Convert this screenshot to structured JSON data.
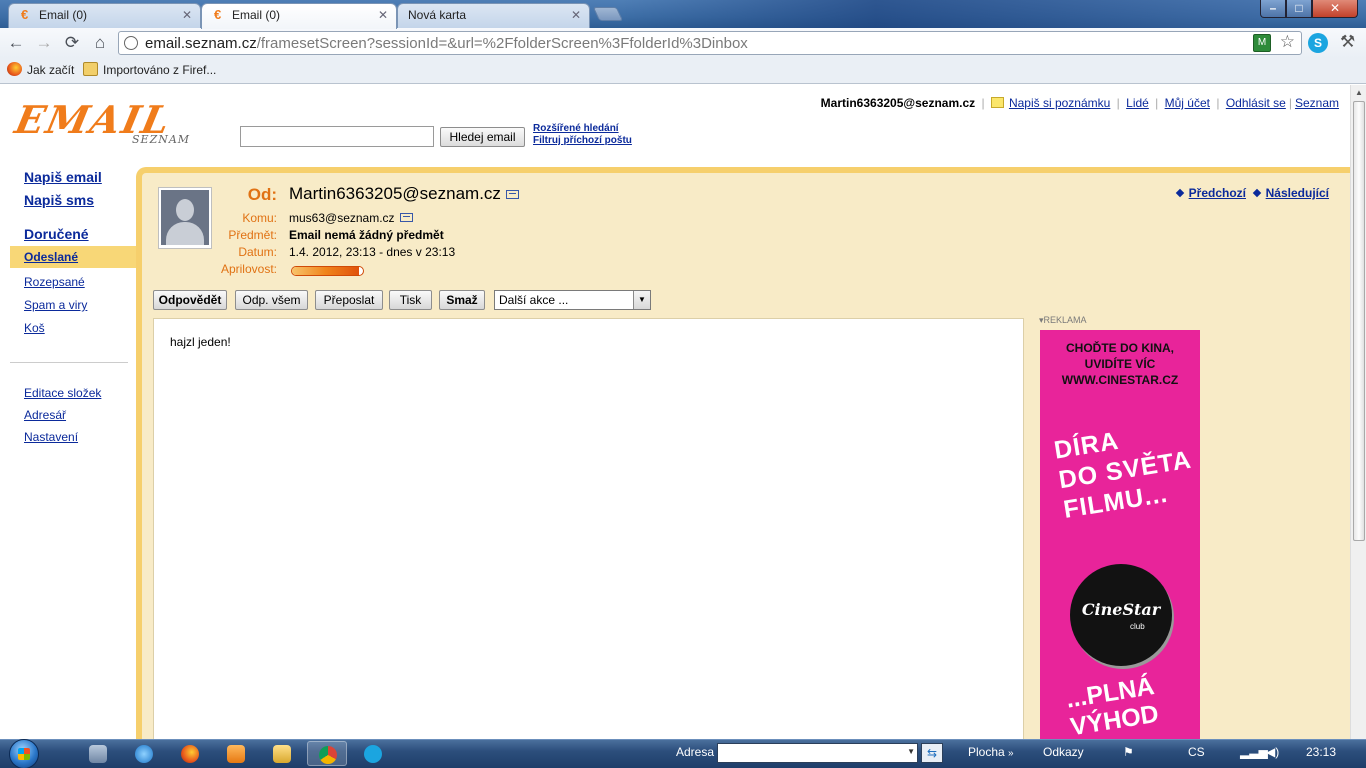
{
  "browser": {
    "tabs": [
      {
        "label": "Email (0)",
        "active": false
      },
      {
        "label": "Email (0)",
        "active": true
      },
      {
        "label": "Nová karta",
        "active": false
      }
    ],
    "url_host": "email.seznam.cz",
    "url_path": "/framesetScreen?sessionId=&url=%2FfolderScreen%3FfolderId%3Dinbox",
    "bookmarks": [
      "Jak začít",
      "Importováno z Firef..."
    ],
    "icons": {
      "back": "←",
      "forward": "→",
      "reload": "⟳",
      "home": "⌂",
      "star": "☆",
      "wrench": "🔧",
      "close": "✕",
      "minimize": "–",
      "maximize": "□"
    }
  },
  "header": {
    "logo_text": "EMAIL",
    "logo_sub": "SEZNAM",
    "search_button": "Hledej email",
    "advanced_search": "Rozšířené hledání",
    "filter_mail": "Filtruj příchozí poštu",
    "user": "Martin6363205@seznam.cz",
    "links": [
      "Napiš si poznámku",
      "Lidé",
      "Můj účet",
      "Odhlásit se",
      "Seznam"
    ]
  },
  "sidebar": {
    "compose_email": "Napiš email",
    "compose_sms": "Napiš sms",
    "inbox": "Doručené",
    "folders": [
      "Odeslané",
      "Rozepsané",
      "Spam a viry",
      "Koš"
    ],
    "active_folder": "Odeslané",
    "settings": [
      "Editace složek",
      "Adresář",
      "Nastavení"
    ]
  },
  "message": {
    "from_label": "Od:",
    "from": "Martin6363205@seznam.cz",
    "to_label": "Komu:",
    "to": "mus63@seznam.cz",
    "subject_label": "Předmět:",
    "subject": "Email nemá žádný předmět",
    "date_label": "Datum:",
    "date": "1.4. 2012, 23:13 - dnes v 23:13",
    "aprilovost_label": "Aprilovost:",
    "aprilovost_level": 0.95,
    "prev": "Předchozí",
    "next": "Následující",
    "body": "hajzl jeden!"
  },
  "actions": {
    "reply": "Odpovědět",
    "reply_all": "Odp. všem",
    "forward": "Přeposlat",
    "print": "Tisk",
    "delete": "Smaž",
    "more": "Další akce ..."
  },
  "ad": {
    "label": "REKLAMA",
    "top_line1": "CHOĎTE DO KINA,",
    "top_line2": "UVIDÍTE VÍC",
    "top_line3": "WWW.CINESTAR.CZ",
    "mid_line1": "DÍRA",
    "mid_line2": "DO SVĚTA",
    "mid_line3": "FILMU...",
    "logo": "CineStar",
    "logo_sub": "club",
    "bottom_line1": "...PLNÁ",
    "bottom_line2": "VÝHOD"
  },
  "taskbar": {
    "address_label": "Adresa",
    "desktop": "Plocha",
    "links": "Odkazy",
    "lang": "CS",
    "time": "23:13"
  }
}
